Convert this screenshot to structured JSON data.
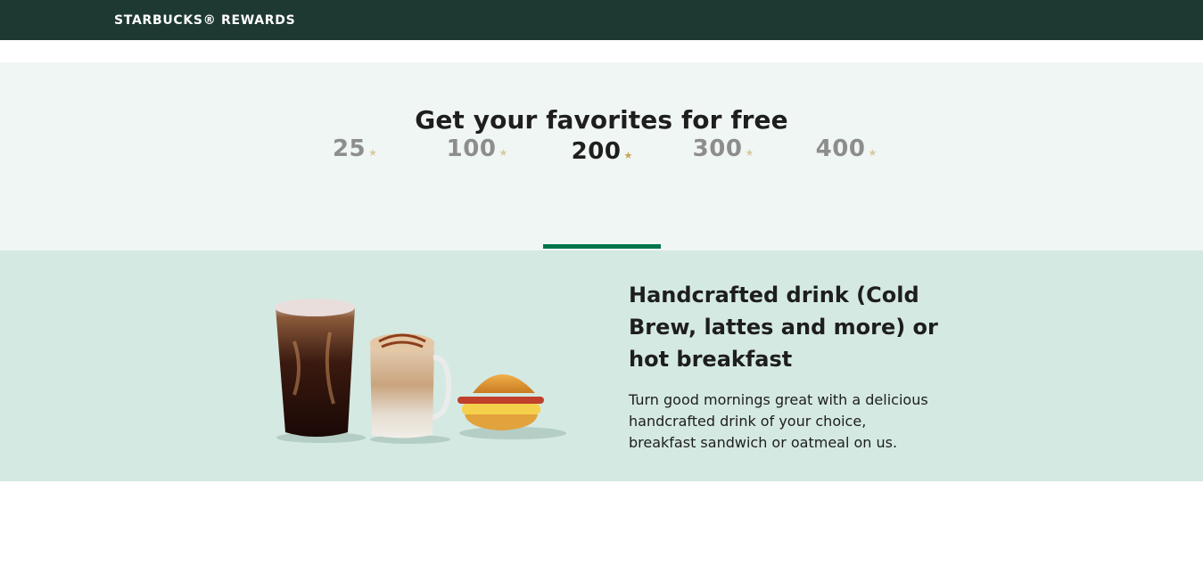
{
  "header": {
    "brand": "STARBUCKS® REWARDS"
  },
  "hero": {
    "title": "Get your favorites for free"
  },
  "tiers": [
    {
      "value": "25",
      "star": "★",
      "active": false
    },
    {
      "value": "100",
      "star": "★",
      "active": false
    },
    {
      "value": "200",
      "star": "★",
      "active": true
    },
    {
      "value": "300",
      "star": "★",
      "active": false
    },
    {
      "value": "400",
      "star": "★",
      "active": false
    }
  ],
  "reward": {
    "title": "Handcrafted drink (Cold Brew, lattes and more) or hot breakfast",
    "description": "Turn good mornings great with a delicious handcrafted drink of your choice, breakfast sandwich or oatmeal on us."
  },
  "colors": {
    "header_bg": "#1e3932",
    "accent_green": "#00754a",
    "hero_bg": "#f0f6f4",
    "panel_bg": "#d4e9e2",
    "star_gold": "#cba258"
  }
}
